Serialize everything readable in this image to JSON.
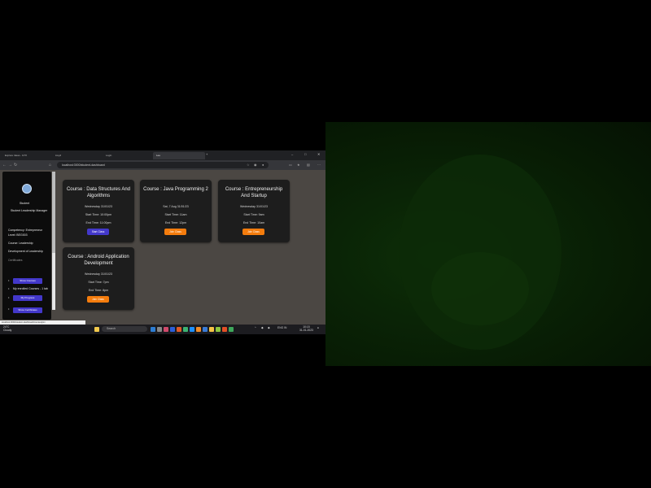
{
  "browser": {
    "tabs": [
      "Explore Ideas - GTX",
      "Lloyd",
      "Login",
      "Lee",
      ""
    ],
    "url": "localhost:3000/student-dashboard"
  },
  "sidebar": {
    "name": "Student",
    "role": "Student Leadership Manager",
    "lines": [
      "Competency: Entrepreneur",
      "Level: BEG003",
      "Course: Leadership",
      "Development of Leadership",
      "Certificates"
    ],
    "buttons": [
      "Show Courses",
      "My Progress",
      "Show Certificates"
    ],
    "bullets": [
      "Courses",
      "Progress",
      "Certificates",
      "Settings"
    ],
    "list_item": "My enrolled Courses - 1 tab",
    "more": "My Courses"
  },
  "cards": [
    {
      "title": "Course : Data Structures And Algorithms",
      "date": "Wednesday 31/01/23",
      "start": "Start Time: 10:00pm",
      "end": "End Time: 11:00pm",
      "button": "Start Class",
      "button_color": "#4338ca"
    },
    {
      "title": "Course : Java Programming 2",
      "date": "Sat, 7 Aug 31/01/23",
      "start": "Start Time: 11am",
      "end": "End Time: 12pm",
      "button": "Join Class",
      "button_color": "#f47c0d"
    },
    {
      "title": "Course : Entrepreneurship And Startup",
      "date": "Wednesday 31/01/23",
      "start": "Start Time: 9am",
      "end": "End Time: 10am",
      "button": "Join Class",
      "button_color": "#f47c0d"
    },
    {
      "title": "Course : Android Application Development",
      "date": "Wednesday 31/01/23",
      "start": "Start Time: 7pm",
      "end": "End Time: 8pm",
      "button": "Join Class",
      "button_color": "#f47c0d"
    }
  ],
  "statusbar": "localhost:3000/student-dashboard/courses/join",
  "taskbar": {
    "weather_temp": "24°C",
    "weather_desc": "Cloudy",
    "search": "Search",
    "time": "10:15",
    "date": "31-01-2023",
    "lang": "ENG IN"
  }
}
